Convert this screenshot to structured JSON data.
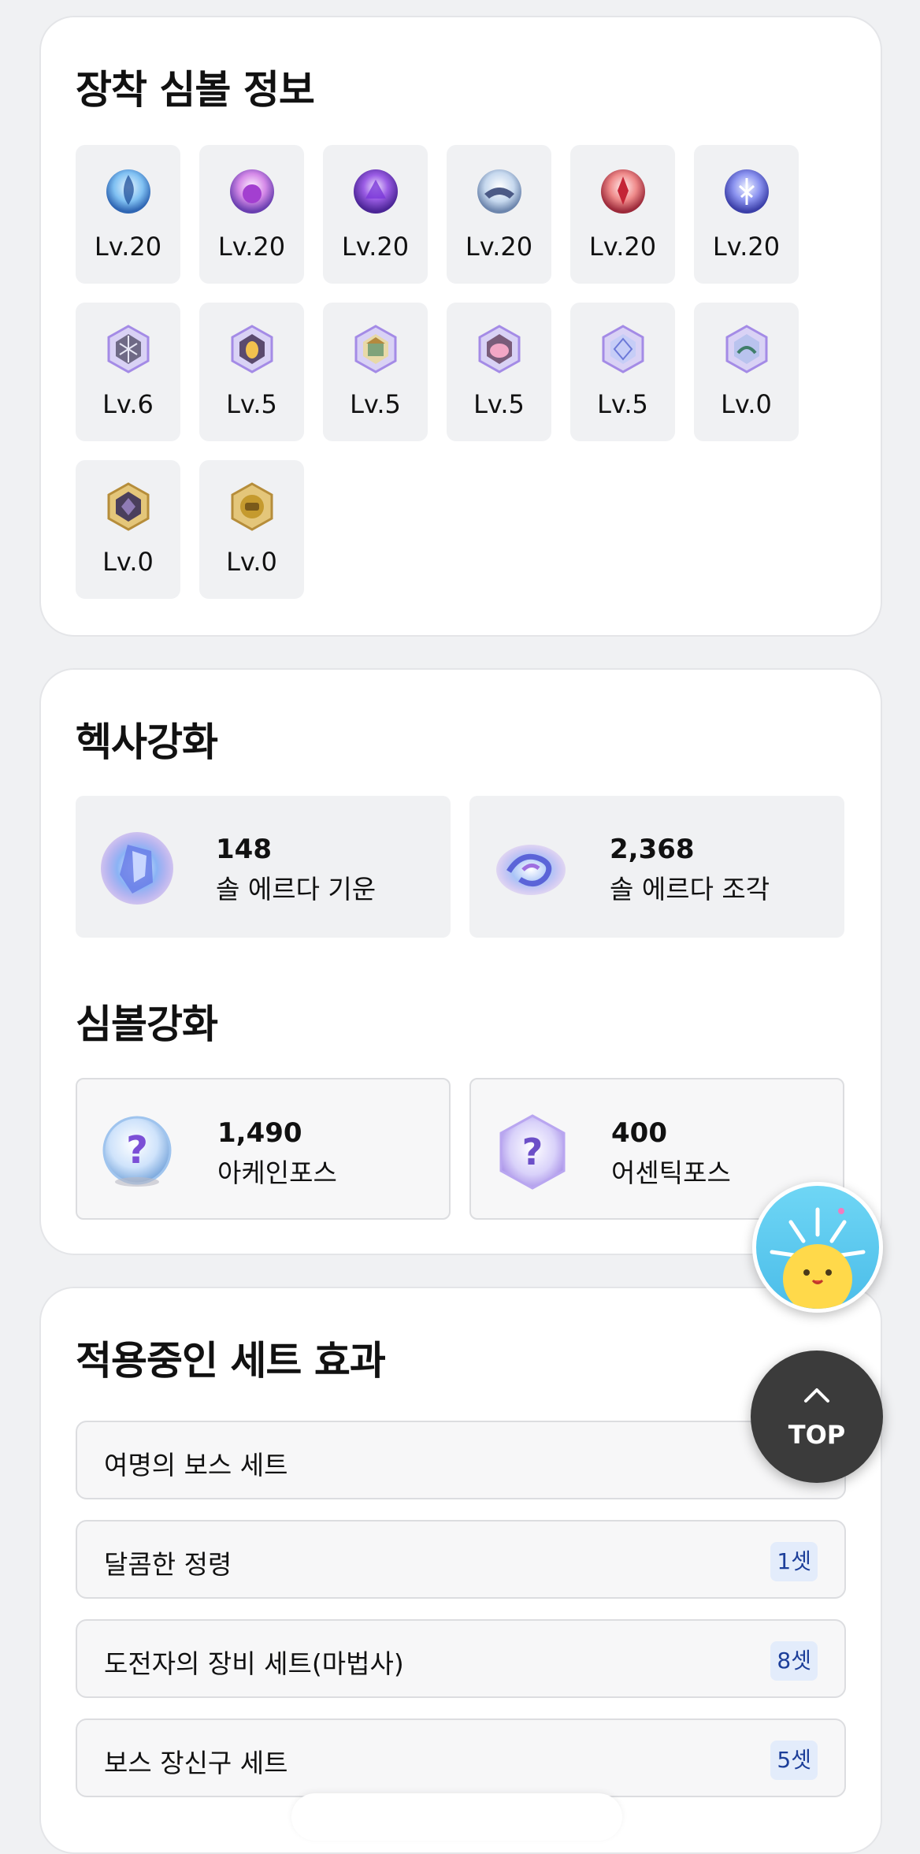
{
  "symbols_card": {
    "title": "장착 심볼 정보",
    "symbols": [
      {
        "icon": "arcane-symbol-vanishing-journey-icon",
        "level": "Lv.20"
      },
      {
        "icon": "arcane-symbol-chu-chu-island-icon",
        "level": "Lv.20"
      },
      {
        "icon": "arcane-symbol-lachelein-icon",
        "level": "Lv.20"
      },
      {
        "icon": "arcane-symbol-arcana-icon",
        "level": "Lv.20"
      },
      {
        "icon": "arcane-symbol-morass-icon",
        "level": "Lv.20"
      },
      {
        "icon": "arcane-symbol-esfera-icon",
        "level": "Lv.20"
      },
      {
        "icon": "authentic-symbol-cernium-icon",
        "level": "Lv.6"
      },
      {
        "icon": "authentic-symbol-arcus-icon",
        "level": "Lv.5"
      },
      {
        "icon": "authentic-symbol-odium-icon",
        "level": "Lv.5"
      },
      {
        "icon": "authentic-symbol-shangri-la-icon",
        "level": "Lv.5"
      },
      {
        "icon": "authentic-symbol-arteria-icon",
        "level": "Lv.5"
      },
      {
        "icon": "authentic-symbol-carcion-icon",
        "level": "Lv.0"
      },
      {
        "icon": "grand-authentic-symbol-tallahart-icon",
        "level": "Lv.0"
      },
      {
        "icon": "grand-authentic-symbol-geardrak-icon",
        "level": "Lv.0"
      }
    ]
  },
  "enhance_card": {
    "hexa_title": "헥사강화",
    "hexa_items": [
      {
        "icon": "sol-erda-energy-icon",
        "value": "148",
        "name": "솔 에르다 기운"
      },
      {
        "icon": "sol-erda-fragment-icon",
        "value": "2,368",
        "name": "솔 에르다 조각"
      }
    ],
    "symbol_title": "심볼강화",
    "symbol_items": [
      {
        "icon": "arcane-force-icon",
        "value": "1,490",
        "name": "아케인포스"
      },
      {
        "icon": "authentic-force-icon",
        "value": "400",
        "name": "어센틱포스"
      }
    ]
  },
  "sets_card": {
    "title": "적용중인 세트 효과",
    "sets": [
      {
        "name": "여명의 보스 세트",
        "count": ""
      },
      {
        "name": "달콤한 정령",
        "count": "1셋"
      },
      {
        "name": "도전자의 장비 세트(마법사)",
        "count": "8셋"
      },
      {
        "name": "보스 장신구 세트",
        "count": "5셋"
      }
    ]
  },
  "floating": {
    "character_icon": "smiling-sun-character-icon",
    "top_label": "TOP"
  },
  "colors": {
    "badge_bg": "#e3ecfb",
    "badge_text": "#1d3f9a",
    "card_bg": "#ffffff",
    "page_bg": "#f0f1f3"
  }
}
